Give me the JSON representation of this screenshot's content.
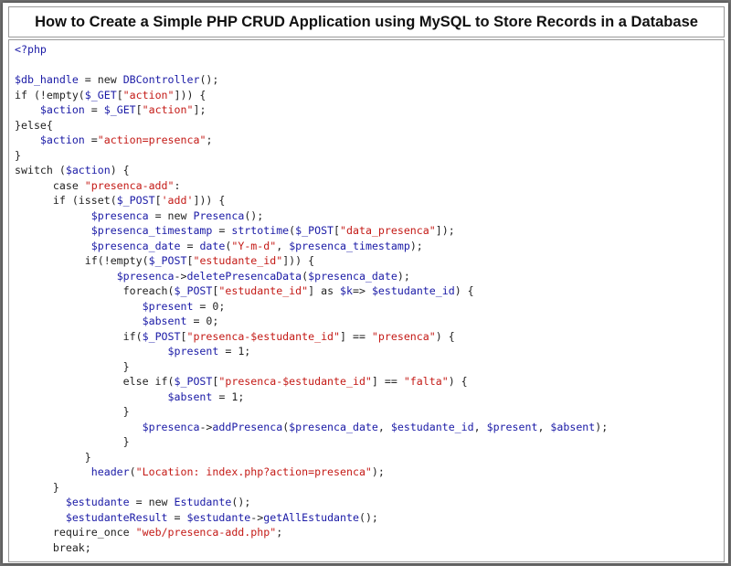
{
  "title": "How to Create a Simple PHP CRUD Application using MySQL to Store Records in a Database",
  "code_lines": [
    [
      {
        "t": "<?php",
        "c": "v"
      }
    ],
    [],
    [
      {
        "t": "$db_handle",
        "c": "v"
      },
      {
        "t": " = new ",
        "c": "k"
      },
      {
        "t": "DBController",
        "c": "f"
      },
      {
        "t": "();",
        "c": "k"
      }
    ],
    [
      {
        "t": "if (!empty(",
        "c": "k"
      },
      {
        "t": "$_GET",
        "c": "v"
      },
      {
        "t": "[",
        "c": "k"
      },
      {
        "t": "\"action\"",
        "c": "s"
      },
      {
        "t": "])) {",
        "c": "k"
      }
    ],
    [
      {
        "t": "    ",
        "c": "k"
      },
      {
        "t": "$action",
        "c": "v"
      },
      {
        "t": " = ",
        "c": "k"
      },
      {
        "t": "$_GET",
        "c": "v"
      },
      {
        "t": "[",
        "c": "k"
      },
      {
        "t": "\"action\"",
        "c": "s"
      },
      {
        "t": "];",
        "c": "k"
      }
    ],
    [
      {
        "t": "}else{",
        "c": "k"
      }
    ],
    [
      {
        "t": "    ",
        "c": "k"
      },
      {
        "t": "$action",
        "c": "v"
      },
      {
        "t": " =",
        "c": "k"
      },
      {
        "t": "\"action=presenca\"",
        "c": "s"
      },
      {
        "t": ";",
        "c": "k"
      }
    ],
    [
      {
        "t": "}",
        "c": "k"
      }
    ],
    [
      {
        "t": "switch (",
        "c": "k"
      },
      {
        "t": "$action",
        "c": "v"
      },
      {
        "t": ") {",
        "c": "k"
      }
    ],
    [
      {
        "t": "      case ",
        "c": "k"
      },
      {
        "t": "\"presenca-add\"",
        "c": "s"
      },
      {
        "t": ":",
        "c": "k"
      }
    ],
    [
      {
        "t": "      if (isset(",
        "c": "k"
      },
      {
        "t": "$_POST",
        "c": "v"
      },
      {
        "t": "[",
        "c": "k"
      },
      {
        "t": "'add'",
        "c": "s"
      },
      {
        "t": "])) {",
        "c": "k"
      }
    ],
    [
      {
        "t": "            ",
        "c": "k"
      },
      {
        "t": "$presenca",
        "c": "v"
      },
      {
        "t": " = new ",
        "c": "k"
      },
      {
        "t": "Presenca",
        "c": "f"
      },
      {
        "t": "();",
        "c": "k"
      }
    ],
    [
      {
        "t": "            ",
        "c": "k"
      },
      {
        "t": "$presenca_timestamp",
        "c": "v"
      },
      {
        "t": " = ",
        "c": "k"
      },
      {
        "t": "strtotime",
        "c": "f"
      },
      {
        "t": "(",
        "c": "k"
      },
      {
        "t": "$_POST",
        "c": "v"
      },
      {
        "t": "[",
        "c": "k"
      },
      {
        "t": "\"data_presenca\"",
        "c": "s"
      },
      {
        "t": "]);",
        "c": "k"
      }
    ],
    [
      {
        "t": "            ",
        "c": "k"
      },
      {
        "t": "$presenca_date",
        "c": "v"
      },
      {
        "t": " = ",
        "c": "k"
      },
      {
        "t": "date",
        "c": "f"
      },
      {
        "t": "(",
        "c": "k"
      },
      {
        "t": "\"Y-m-d\"",
        "c": "s"
      },
      {
        "t": ", ",
        "c": "k"
      },
      {
        "t": "$presenca_timestamp",
        "c": "v"
      },
      {
        "t": ");",
        "c": "k"
      }
    ],
    [
      {
        "t": "           if(!empty(",
        "c": "k"
      },
      {
        "t": "$_POST",
        "c": "v"
      },
      {
        "t": "[",
        "c": "k"
      },
      {
        "t": "\"estudante_id\"",
        "c": "s"
      },
      {
        "t": "])) {",
        "c": "k"
      }
    ],
    [
      {
        "t": "                ",
        "c": "k"
      },
      {
        "t": "$presenca",
        "c": "v"
      },
      {
        "t": "->",
        "c": "k"
      },
      {
        "t": "deletePresencaData",
        "c": "f"
      },
      {
        "t": "(",
        "c": "k"
      },
      {
        "t": "$presenca_date",
        "c": "v"
      },
      {
        "t": ");",
        "c": "k"
      }
    ],
    [
      {
        "t": "                 foreach(",
        "c": "k"
      },
      {
        "t": "$_POST",
        "c": "v"
      },
      {
        "t": "[",
        "c": "k"
      },
      {
        "t": "\"estudante_id\"",
        "c": "s"
      },
      {
        "t": "] as ",
        "c": "k"
      },
      {
        "t": "$k",
        "c": "v"
      },
      {
        "t": "=> ",
        "c": "k"
      },
      {
        "t": "$estudante_id",
        "c": "v"
      },
      {
        "t": ") {",
        "c": "k"
      }
    ],
    [
      {
        "t": "                    ",
        "c": "k"
      },
      {
        "t": "$present",
        "c": "v"
      },
      {
        "t": " = 0;",
        "c": "k"
      }
    ],
    [
      {
        "t": "                    ",
        "c": "k"
      },
      {
        "t": "$absent",
        "c": "v"
      },
      {
        "t": " = 0;",
        "c": "k"
      }
    ],
    [
      {
        "t": "                 if(",
        "c": "k"
      },
      {
        "t": "$_POST",
        "c": "v"
      },
      {
        "t": "[",
        "c": "k"
      },
      {
        "t": "\"presenca-$estudante_id\"",
        "c": "s"
      },
      {
        "t": "] == ",
        "c": "k"
      },
      {
        "t": "\"presenca\"",
        "c": "s"
      },
      {
        "t": ") {",
        "c": "k"
      }
    ],
    [
      {
        "t": "                        ",
        "c": "k"
      },
      {
        "t": "$present",
        "c": "v"
      },
      {
        "t": " = 1;",
        "c": "k"
      }
    ],
    [
      {
        "t": "                 }",
        "c": "k"
      }
    ],
    [
      {
        "t": "                 else if(",
        "c": "k"
      },
      {
        "t": "$_POST",
        "c": "v"
      },
      {
        "t": "[",
        "c": "k"
      },
      {
        "t": "\"presenca-$estudante_id\"",
        "c": "s"
      },
      {
        "t": "] == ",
        "c": "k"
      },
      {
        "t": "\"falta\"",
        "c": "s"
      },
      {
        "t": ") {",
        "c": "k"
      }
    ],
    [
      {
        "t": "                        ",
        "c": "k"
      },
      {
        "t": "$absent",
        "c": "v"
      },
      {
        "t": " = 1;",
        "c": "k"
      }
    ],
    [
      {
        "t": "                 }",
        "c": "k"
      }
    ],
    [
      {
        "t": "                    ",
        "c": "k"
      },
      {
        "t": "$presenca",
        "c": "v"
      },
      {
        "t": "->",
        "c": "k"
      },
      {
        "t": "addPresenca",
        "c": "f"
      },
      {
        "t": "(",
        "c": "k"
      },
      {
        "t": "$presenca_date",
        "c": "v"
      },
      {
        "t": ", ",
        "c": "k"
      },
      {
        "t": "$estudante_id",
        "c": "v"
      },
      {
        "t": ", ",
        "c": "k"
      },
      {
        "t": "$present",
        "c": "v"
      },
      {
        "t": ", ",
        "c": "k"
      },
      {
        "t": "$absent",
        "c": "v"
      },
      {
        "t": ");",
        "c": "k"
      }
    ],
    [
      {
        "t": "                 }",
        "c": "k"
      }
    ],
    [
      {
        "t": "           }",
        "c": "k"
      }
    ],
    [
      {
        "t": "            ",
        "c": "k"
      },
      {
        "t": "header",
        "c": "f"
      },
      {
        "t": "(",
        "c": "k"
      },
      {
        "t": "\"Location: index.php?action=presenca\"",
        "c": "s"
      },
      {
        "t": ");",
        "c": "k"
      }
    ],
    [
      {
        "t": "      }",
        "c": "k"
      }
    ],
    [
      {
        "t": "        ",
        "c": "k"
      },
      {
        "t": "$estudante",
        "c": "v"
      },
      {
        "t": " = new ",
        "c": "k"
      },
      {
        "t": "Estudante",
        "c": "f"
      },
      {
        "t": "();",
        "c": "k"
      }
    ],
    [
      {
        "t": "        ",
        "c": "k"
      },
      {
        "t": "$estudanteResult",
        "c": "v"
      },
      {
        "t": " = ",
        "c": "k"
      },
      {
        "t": "$estudante",
        "c": "v"
      },
      {
        "t": "->",
        "c": "k"
      },
      {
        "t": "getAllEstudante",
        "c": "f"
      },
      {
        "t": "();",
        "c": "k"
      }
    ],
    [
      {
        "t": "      require_once ",
        "c": "k"
      },
      {
        "t": "\"web/presenca-add.php\"",
        "c": "s"
      },
      {
        "t": ";",
        "c": "k"
      }
    ],
    [
      {
        "t": "      break;",
        "c": "k"
      }
    ]
  ]
}
